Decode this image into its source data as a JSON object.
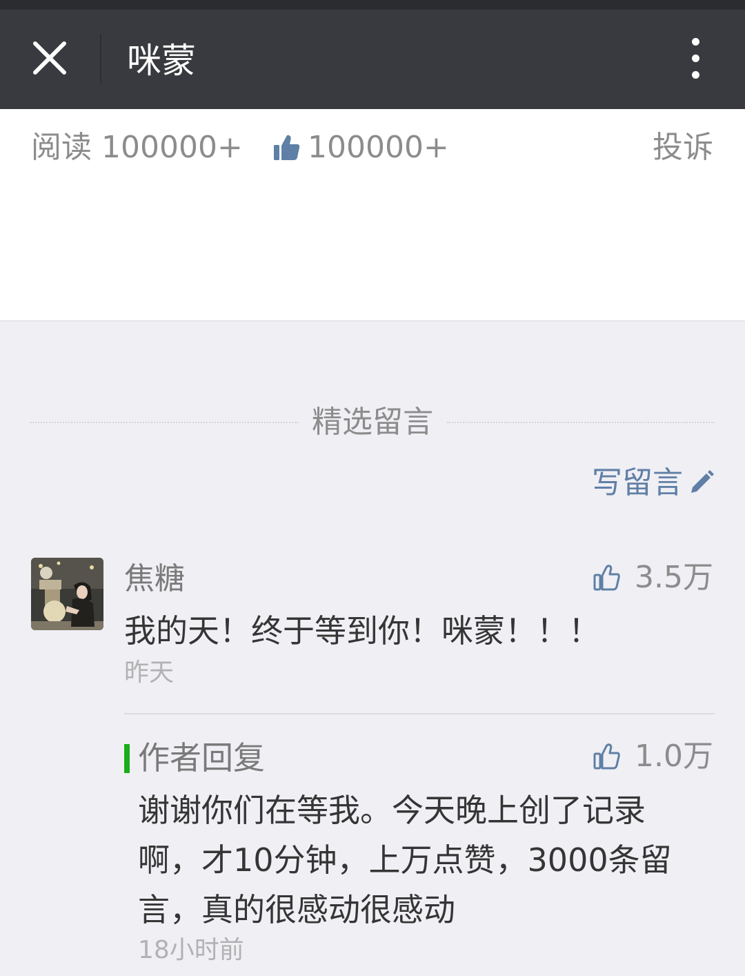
{
  "header": {
    "title": "咪蒙",
    "close_icon": "close-icon",
    "more_icon": "more-vertical-icon",
    "bg_color": "#393a3f"
  },
  "article_footer": {
    "reads_label": "阅读",
    "reads_count": "100000+",
    "likes_count": "100000+",
    "report_label": "投诉"
  },
  "comments_section": {
    "title": "精选留言",
    "write_label": "写留言",
    "write_icon": "pencil-icon",
    "link_color": "#607fa6"
  },
  "comments": [
    {
      "nickname": "焦糖",
      "likes": "3.5万",
      "text": "我的天！终于等到你！咪蒙！！！",
      "time": "昨天",
      "reply": {
        "label": "作者回复",
        "likes": "1.0万",
        "text": "谢谢你们在等我。今天晚上创了记录啊，才10分钟，上万点赞，3000条留言，真的很感动很感动",
        "time": "18小时前",
        "accent_color": "#1aad19"
      }
    }
  ]
}
